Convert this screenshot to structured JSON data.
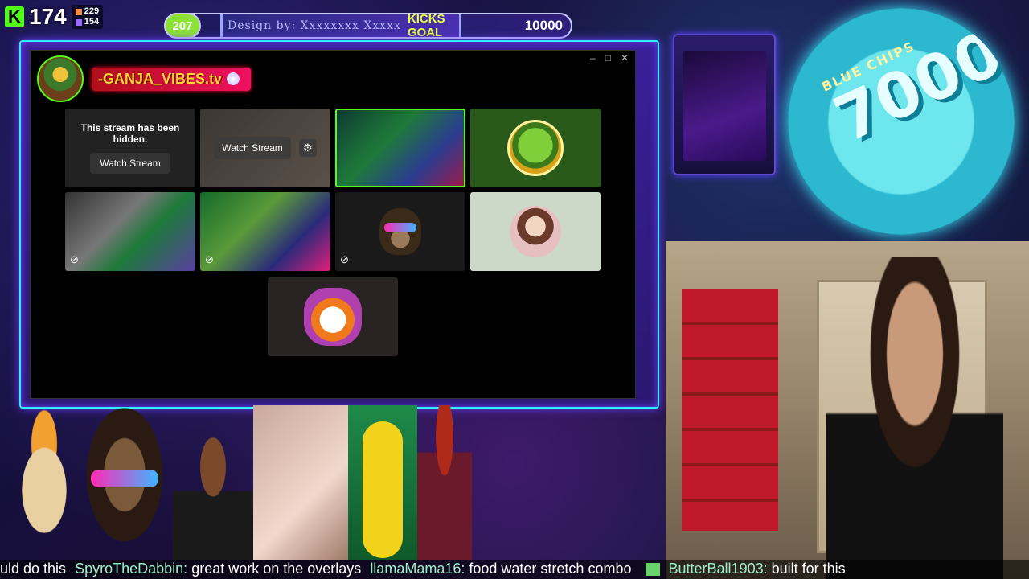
{
  "overlay": {
    "platform_icon": "kick-logo-icon",
    "viewer_count": "174",
    "followers": "229",
    "subs": "154"
  },
  "goal": {
    "current": "207",
    "design_credit": "Design by: Xxxxxxxx Xxxxx",
    "label": "KICKS GOAL",
    "target": "10000",
    "progress_fraction": 0.0207
  },
  "window": {
    "controls": [
      "–",
      "□",
      "✕"
    ],
    "channel_name": "-GANJA_VIBES.tv"
  },
  "tiles": [
    {
      "type": "hidden",
      "text": "This stream has been hidden.",
      "button": "Watch Stream"
    },
    {
      "type": "watch",
      "button": "Watch Stream"
    },
    {
      "type": "stream_preview"
    },
    {
      "type": "avatar_pepe"
    },
    {
      "type": "stream_preview_muted"
    },
    {
      "type": "stream_preview_muted"
    },
    {
      "type": "avatar_ape_muted"
    },
    {
      "type": "avatar_girl"
    },
    {
      "type": "avatar_ghost"
    }
  ],
  "badge": {
    "small_text": "BLUE CHIPS",
    "big_text": "7000"
  },
  "ticker": [
    {
      "user": "",
      "msg": "uld do this"
    },
    {
      "user": "SpyroTheDabbin:",
      "msg": "great work on the overlays"
    },
    {
      "user": "llamaMama16:",
      "msg": "food water stretch combo"
    },
    {
      "user": "ButterBall1903:",
      "msg": "built for this"
    }
  ]
}
